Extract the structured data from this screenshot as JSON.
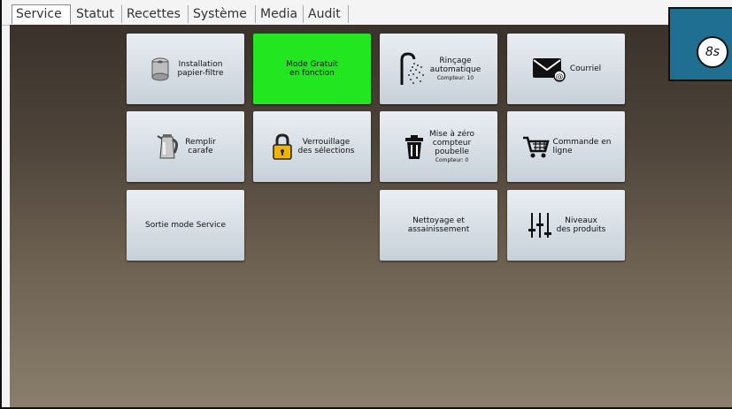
{
  "tabs": [
    "Service",
    "Statut",
    "Recettes",
    "Système",
    "Media",
    "Audit"
  ],
  "timer": "8s",
  "tiles": {
    "installation": {
      "label1": "Installation",
      "label2": "papier-filtre",
      "icon": "filter-roll-icon"
    },
    "mode_gratuit": {
      "label1": "Mode Gratuit",
      "label2": "en fonction",
      "color": "#22e61f"
    },
    "rincage": {
      "label1": "Rinçage",
      "label2": "automatique",
      "sub": "Compteur: 10",
      "icon": "shower-icon"
    },
    "courriel": {
      "label": "Courriel",
      "icon": "email-icon"
    },
    "remplir": {
      "label1": "Remplir",
      "label2": "carafe",
      "icon": "kettle-icon"
    },
    "verrouillage": {
      "label1": "Verrouillage",
      "label2": "des sélections",
      "icon": "padlock-icon"
    },
    "mise_zero": {
      "label1": "Mise à zéro",
      "label2": "compteur",
      "label3": "poubelle",
      "sub": "Compteur: 0",
      "icon": "trash-icon"
    },
    "commande": {
      "label1": "Commande en",
      "label2": "ligne",
      "icon": "cart-icon"
    },
    "sortie": {
      "label": "Sortie mode Service"
    },
    "nettoyage": {
      "label1": "Nettoyage et",
      "label2": "assainissement"
    },
    "niveaux": {
      "label1": "Niveaux",
      "label2": "des produits",
      "icon": "sliders-icon"
    }
  }
}
